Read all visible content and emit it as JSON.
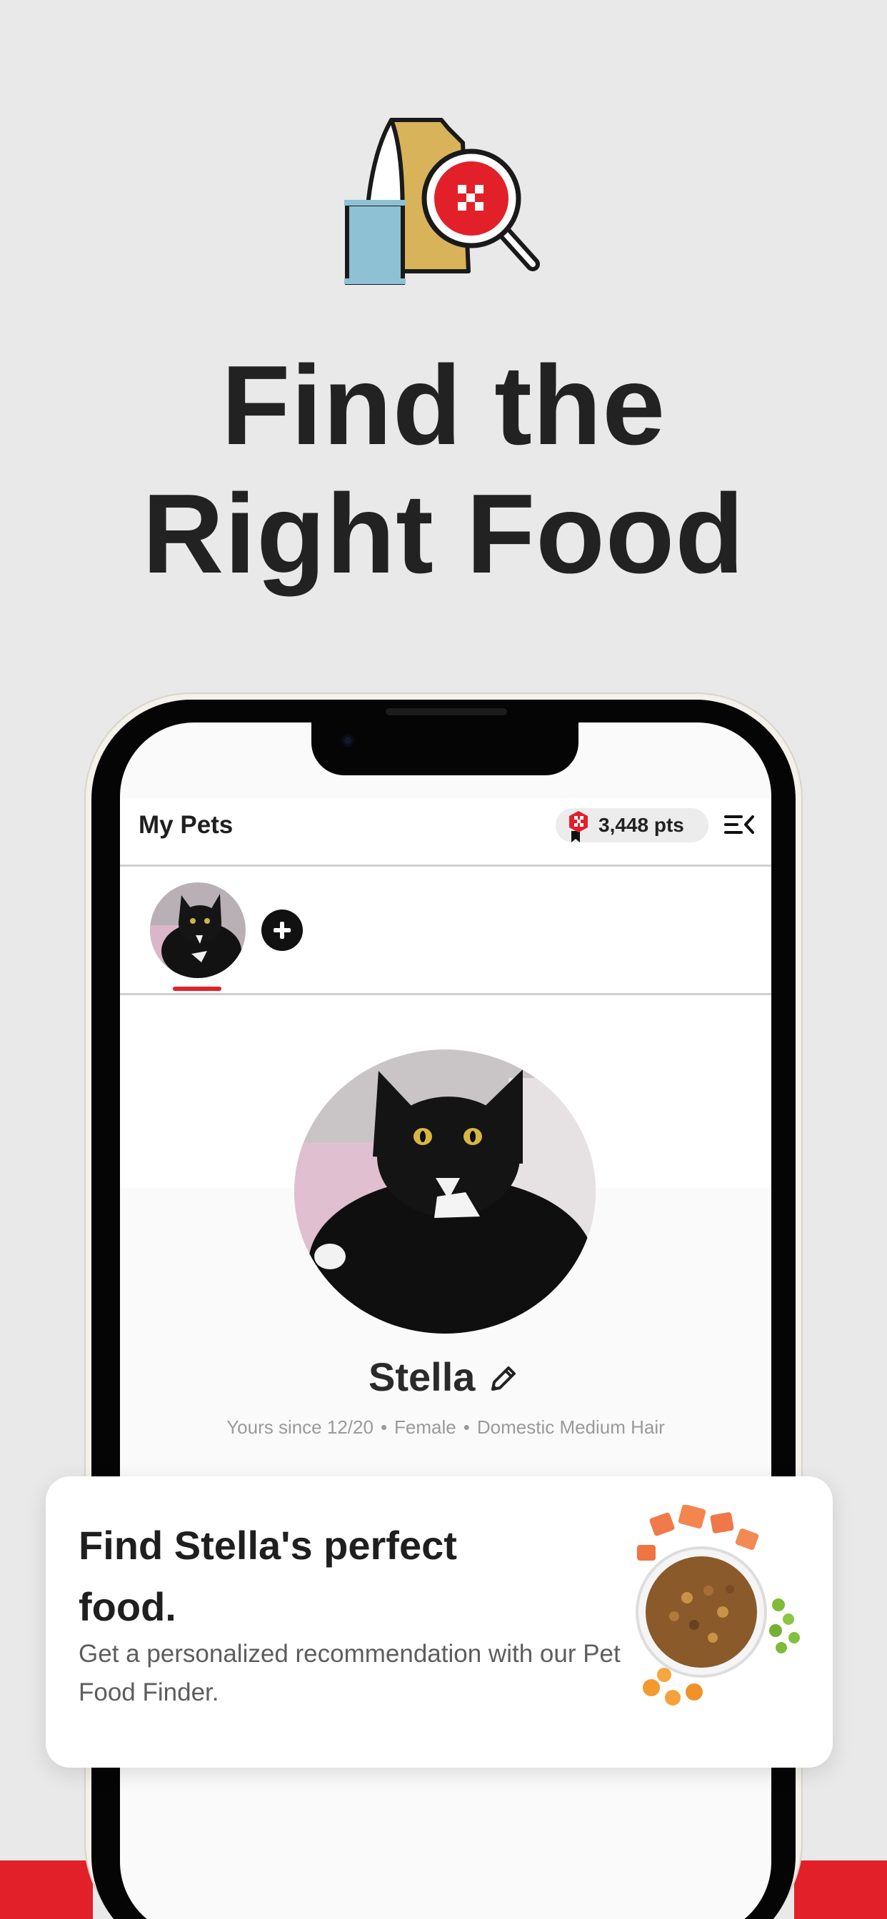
{
  "hero": {
    "title_line1": "Find the",
    "title_line2": "Right Food",
    "illustration": "pet-food-bag-magnifier-icon"
  },
  "colors": {
    "brand_red": "#e2202a",
    "background": "#e9e9e9",
    "bag_gold": "#d8b35a",
    "can_blue": "#8fc1d4"
  },
  "app": {
    "header": {
      "title": "My Pets",
      "points": "3,448 pts",
      "points_icon": "rewards-badge-icon",
      "menu_icon": "menu-collapse-icon"
    },
    "pets_strip": {
      "selected_pet_photo": "cat-avatar",
      "add_icon": "plus-circle-icon"
    },
    "profile": {
      "name": "Stella",
      "edit_icon": "pencil-icon",
      "meta": [
        "Yours since 12/20",
        "Female",
        "Domestic Medium Hair"
      ],
      "separator": "•"
    }
  },
  "finder_card": {
    "title": "Find Stella's perfect food.",
    "description": "Get a personalized recommendation with our Pet Food Finder.",
    "image": "pet-food-bowl-image"
  }
}
